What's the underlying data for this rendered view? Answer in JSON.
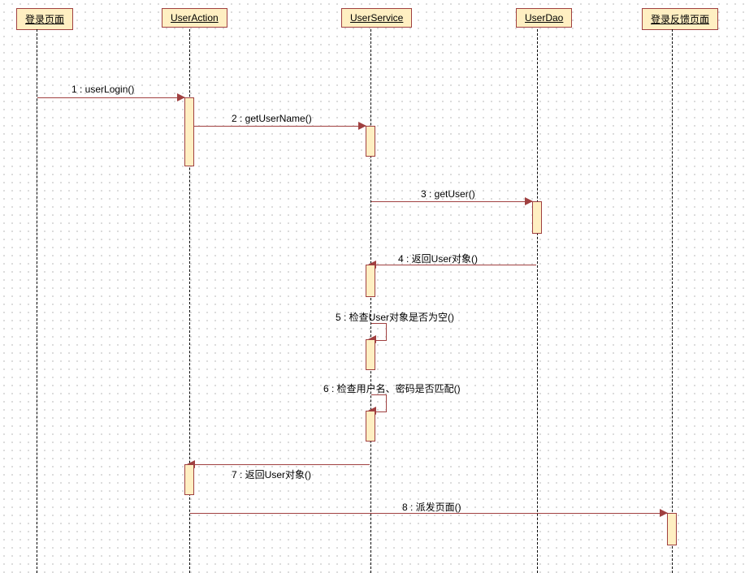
{
  "participants": {
    "p1": "登录页面",
    "p2": "UserAction",
    "p3": "UserService",
    "p4": "UserDao",
    "p5": "登录反馈页面"
  },
  "messages": {
    "m1": "1 : userLogin()",
    "m2": "2 : getUserName()",
    "m3": "3 : getUser()",
    "m4": "4 : 返回User对象()",
    "m5": "5 : 检查User对象是否为空()",
    "m6": "6 : 检查用户名、密码是否匹配()",
    "m7": "7 : 返回User对象()",
    "m8": "8 : 派发页面()"
  },
  "chart_data": {
    "type": "sequence-diagram",
    "participants": [
      "登录页面",
      "UserAction",
      "UserService",
      "UserDao",
      "登录反馈页面"
    ],
    "interactions": [
      {
        "seq": 1,
        "from": "登录页面",
        "to": "UserAction",
        "label": "userLogin()",
        "kind": "call"
      },
      {
        "seq": 2,
        "from": "UserAction",
        "to": "UserService",
        "label": "getUserName()",
        "kind": "call"
      },
      {
        "seq": 3,
        "from": "UserService",
        "to": "UserDao",
        "label": "getUser()",
        "kind": "call"
      },
      {
        "seq": 4,
        "from": "UserDao",
        "to": "UserService",
        "label": "返回User对象()",
        "kind": "return"
      },
      {
        "seq": 5,
        "from": "UserService",
        "to": "UserService",
        "label": "检查User对象是否为空()",
        "kind": "self"
      },
      {
        "seq": 6,
        "from": "UserService",
        "to": "UserService",
        "label": "检查用户名、密码是否匹配()",
        "kind": "self"
      },
      {
        "seq": 7,
        "from": "UserService",
        "to": "UserAction",
        "label": "返回User对象()",
        "kind": "return"
      },
      {
        "seq": 8,
        "from": "UserAction",
        "to": "登录反馈页面",
        "label": "派发页面()",
        "kind": "call"
      }
    ]
  }
}
